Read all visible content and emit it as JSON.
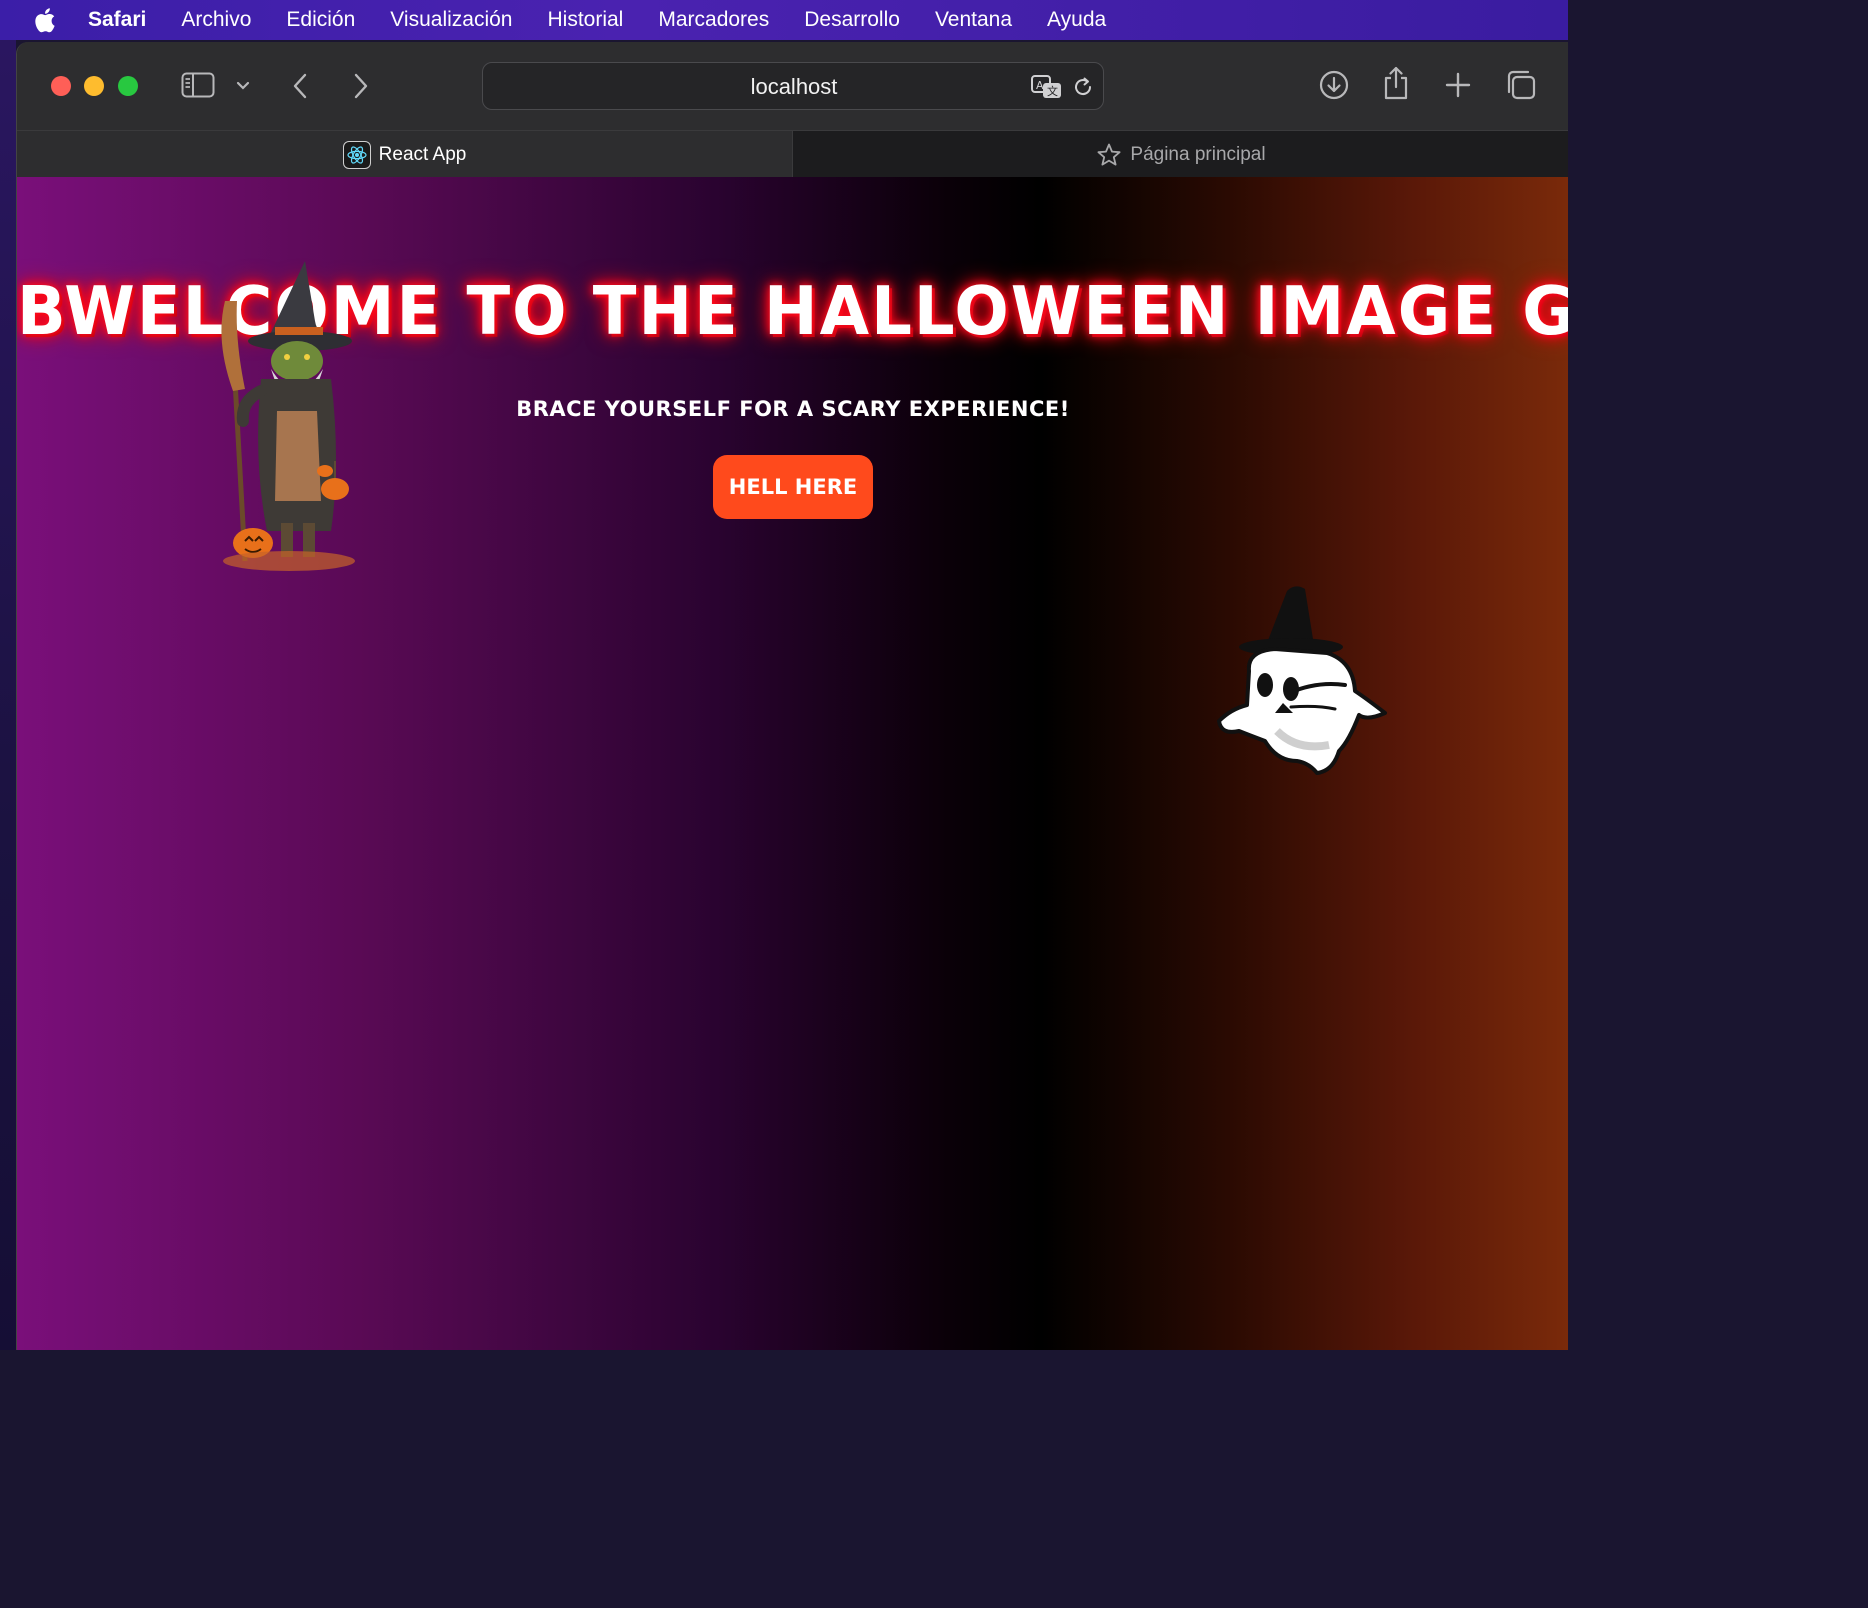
{
  "menubar": {
    "app_name": "Safari",
    "items": [
      "Archivo",
      "Edición",
      "Visualización",
      "Historial",
      "Marcadores",
      "Desarrollo",
      "Ventana",
      "Ayuda"
    ]
  },
  "toolbar": {
    "url": "localhost",
    "icons": [
      "sidebar-icon",
      "chevron-down-icon",
      "back-icon",
      "forward-icon",
      "translate-icon",
      "reload-icon",
      "download-icon",
      "share-icon",
      "new-tab-icon",
      "tab-overview-icon"
    ]
  },
  "tabs": {
    "active_label": "React App",
    "inactive_label": "Página principal"
  },
  "page": {
    "title": "BWELCOME TO THE HALLOWEEN IMAGE GENERATOR",
    "subtitle": "BRACE YOURSELF FOR A SCARY EXPERIENCE!",
    "button_label": "HELL HERE"
  },
  "colors": {
    "menubar": "#3b1ea8",
    "button": "#ff4a1c",
    "title_glow": "#ff1020",
    "bg_left": "#7a0f7a",
    "bg_mid": "#000000",
    "bg_right": "#7a2a0a"
  }
}
